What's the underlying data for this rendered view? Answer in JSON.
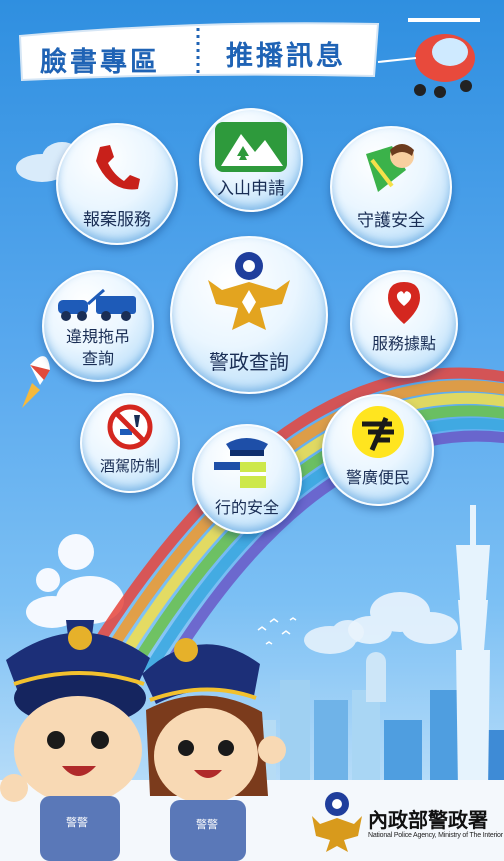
{
  "banner": {
    "left": "臉書專區",
    "right": "推播訊息"
  },
  "menu": {
    "report": "報案服務",
    "mountain": "入山申請",
    "guard": "守護安全",
    "tow": "違規拖吊\n查詢",
    "query": "警政查詢",
    "service": "服務據點",
    "drunk": "酒駕防制",
    "traffic": "行的安全",
    "broadcast": "警廣便民"
  },
  "badges": {
    "police": "警警"
  },
  "footer": {
    "agency_zh": "內政部警政署",
    "agency_en": "National Police Agency, Ministry of The Interior"
  },
  "colors": {
    "sky": "#4a9fe8",
    "banner_text": "#1f63b5",
    "label": "#1a2e55"
  }
}
